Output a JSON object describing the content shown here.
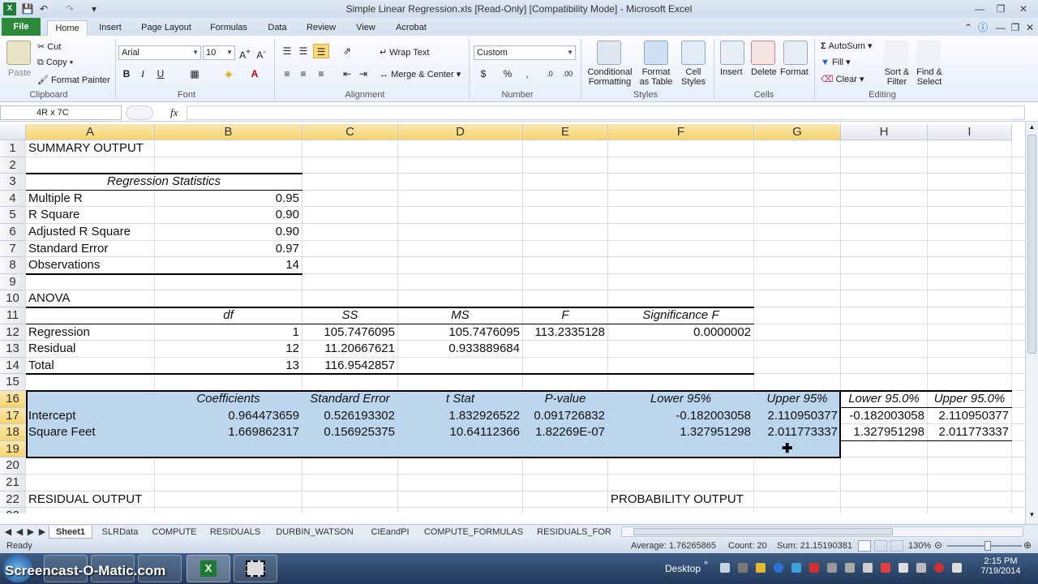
{
  "window": {
    "title": "Simple Linear Regression.xls  [Read-Only]  [Compatibility Mode]  -  Microsoft Excel"
  },
  "tabs": [
    "File",
    "Home",
    "Insert",
    "Page Layout",
    "Formulas",
    "Data",
    "Review",
    "View",
    "Acrobat"
  ],
  "ribbon": {
    "clipboard": {
      "paste": "Paste",
      "cut": "Cut",
      "copy": "Copy",
      "format_painter": "Format Painter",
      "label": "Clipboard"
    },
    "font": {
      "name": "Arial",
      "size": "10",
      "label": "Font"
    },
    "alignment": {
      "wrap": "Wrap Text",
      "merge": "Merge & Center",
      "label": "Alignment"
    },
    "number": {
      "format": "Custom",
      "label": "Number"
    },
    "styles": {
      "conditional_1": "Conditional",
      "conditional_2": "Formatting",
      "format_table_1": "Format",
      "format_table_2": "as Table",
      "cell_styles_1": "Cell",
      "cell_styles_2": "Styles",
      "label": "Styles"
    },
    "cells": {
      "insert": "Insert",
      "delete": "Delete",
      "format": "Format",
      "label": "Cells"
    },
    "editing": {
      "autosum": "AutoSum",
      "fill": "Fill",
      "clear": "Clear",
      "sort_1": "Sort &",
      "sort_2": "Filter",
      "find_1": "Find &",
      "find_2": "Select",
      "label": "Editing"
    }
  },
  "formula_bar": {
    "name_box": "4R x 7C",
    "fx": "fx",
    "content": ""
  },
  "columns": [
    "A",
    "B",
    "C",
    "D",
    "E",
    "F",
    "G",
    "H",
    "I"
  ],
  "rows": [
    "1",
    "2",
    "3",
    "4",
    "5",
    "6",
    "7",
    "8",
    "9",
    "10",
    "11",
    "12",
    "13",
    "14",
    "15",
    "16",
    "17",
    "18",
    "19",
    "20",
    "21",
    "22",
    "23"
  ],
  "cells": {
    "A1": "SUMMARY OUTPUT",
    "A3": "Regression Statistics",
    "A4": "Multiple R",
    "B4": "0.95",
    "A5": "R Square",
    "B5": "0.90",
    "A6": "Adjusted R Square",
    "B6": "0.90",
    "A7": "Standard Error",
    "B7": "0.97",
    "A8": "Observations",
    "B8": "14",
    "A10": "ANOVA",
    "B11": "df",
    "C11": "SS",
    "D11": "MS",
    "E11": "F",
    "F11": "Significance F",
    "A12": "Regression",
    "B12": "1",
    "C12": "105.7476095",
    "D12": "105.7476095",
    "E12": "113.2335128",
    "F12": "0.0000002",
    "A13": "Residual",
    "B13": "12",
    "C13": "11.20667621",
    "D13": "0.933889684",
    "A14": "Total",
    "B14": "13",
    "C14": "116.9542857",
    "B16": "Coefficients",
    "C16": "Standard Error",
    "D16": "t Stat",
    "E16": "P-value",
    "F16": "Lower 95%",
    "G16": "Upper 95%",
    "H16": "Lower 95.0%",
    "I16": "Upper 95.0%",
    "A17": "Intercept",
    "B17": "0.964473659",
    "C17": "0.526193302",
    "D17": "1.832926522",
    "E17": "0.091726832",
    "F17": "-0.182003058",
    "G17": "2.110950377",
    "H17": "-0.182003058",
    "I17": "2.110950377",
    "A18": "Square Feet",
    "B18": "1.669862317",
    "C18": "0.156925375",
    "D18": "10.64112366",
    "E18": "1.82269E-07",
    "F18": "1.327951298",
    "G18": "2.011773337",
    "H18": "1.327951298",
    "I18": "2.011773337",
    "A22": "RESIDUAL OUTPUT",
    "F22": "PROBABILITY OUTPUT"
  },
  "sheet_tabs": [
    "Sheet1",
    "SLRData",
    "COMPUTE",
    "RESIDUALS",
    "DURBIN_WATSON",
    "CIEandPI",
    "COMPUTE_FORMULAS",
    "RESIDUALS_FOR"
  ],
  "status": {
    "ready": "Ready",
    "average": "Average: 1.76265865",
    "count": "Count: 20",
    "sum": "Sum: 21.15190381",
    "zoom": "130%"
  },
  "taskbar": {
    "watermark": "Screencast-O-Matic.com",
    "desktop": "Desktop",
    "time": "2:15 PM",
    "date": "7/19/2014"
  }
}
